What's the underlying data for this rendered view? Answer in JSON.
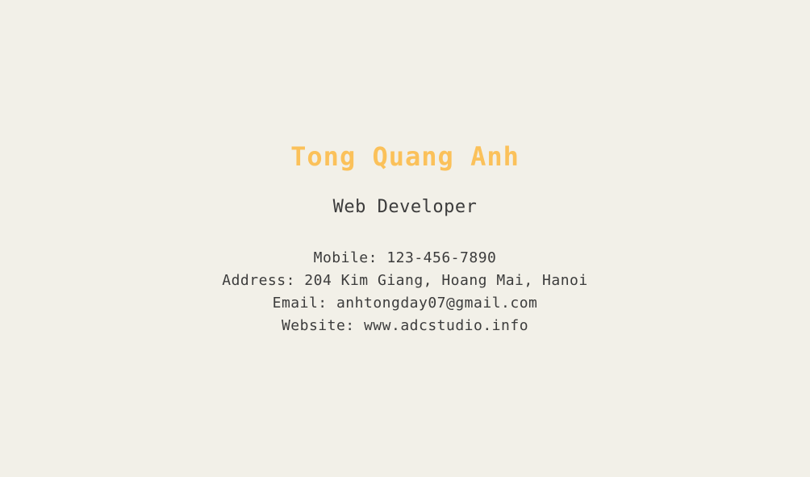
{
  "profile": {
    "name": "Tong Quang Anh",
    "role": "Web Developer"
  },
  "contacts": {
    "mobile": "Mobile: 123-456-7890",
    "address": "Address: 204 Kim Giang, Hoang Mai, Hanoi",
    "email": "Email: anhtongday07@gmail.com",
    "website": "Website: www.adcstudio.info"
  },
  "colors": {
    "background": "#f2f0e8",
    "accent": "#fbc15a",
    "text": "#3c3c3c"
  }
}
